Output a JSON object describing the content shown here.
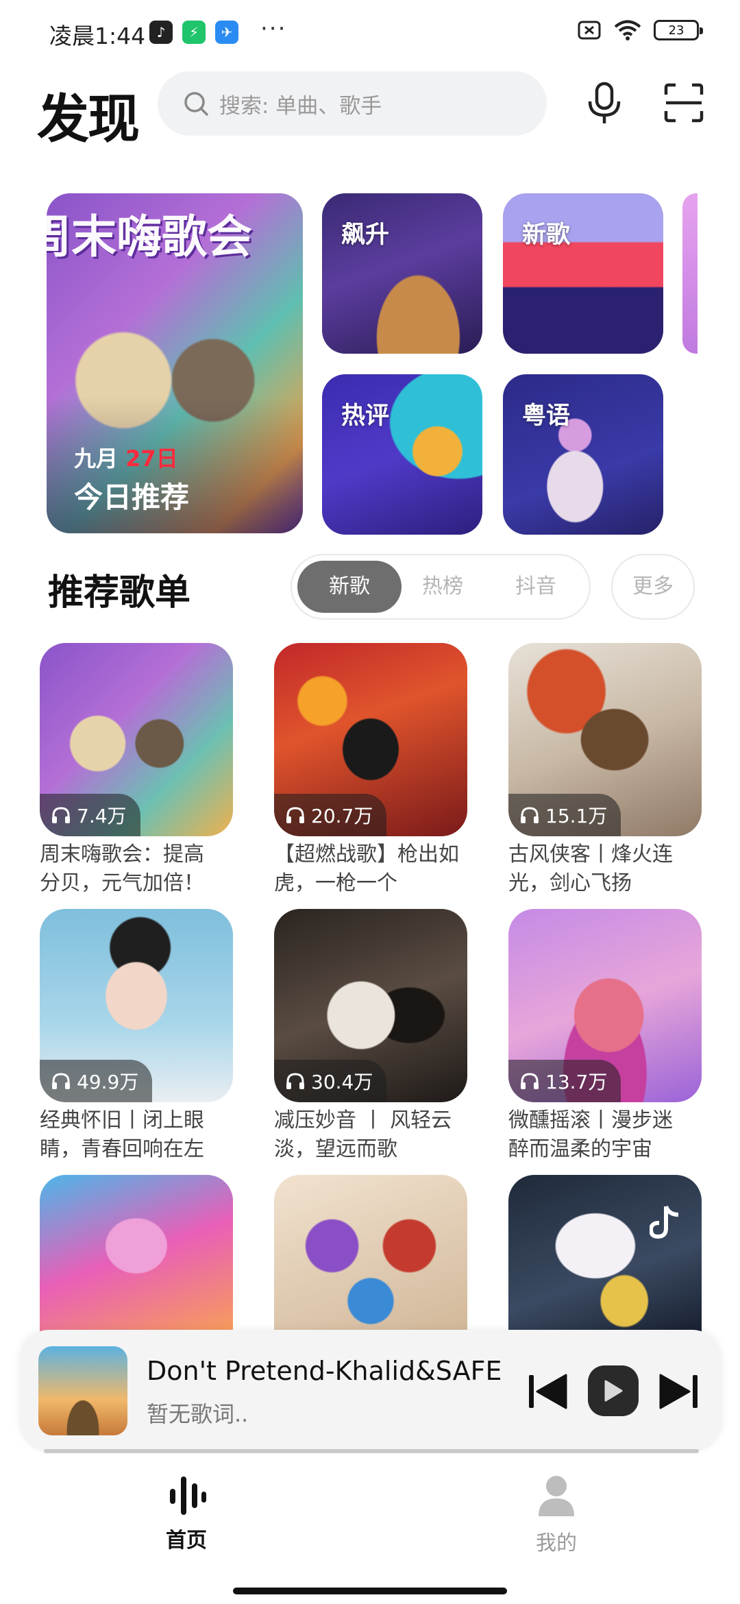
{
  "status": {
    "time": "凌晨1:44",
    "more": "···",
    "battery": "23"
  },
  "header": {
    "title": "发现",
    "search_placeholder": "搜索: 单曲、歌手"
  },
  "banners": {
    "big": {
      "art_title": "周末嗨歌会",
      "month": "九月",
      "day": "27日",
      "label": "今日推荐"
    },
    "small": [
      {
        "label": "飙升"
      },
      {
        "label": "新歌"
      },
      {
        "label": "热评"
      },
      {
        "label": "粤语"
      }
    ]
  },
  "section": {
    "title": "推荐歌单",
    "tabs": [
      "新歌",
      "热榜",
      "抖音"
    ],
    "more": "更多"
  },
  "playlists": [
    {
      "count": "7.4万",
      "title_line1": "周末嗨歌会：提高",
      "title_line2": "分贝，元气加倍！"
    },
    {
      "count": "20.7万",
      "title_line1": "【超燃战歌】枪出如",
      "title_line2": "虎，一枪一个"
    },
    {
      "count": "15.1万",
      "title_line1": "古风侠客丨烽火连",
      "title_line2": "光，剑心飞扬"
    },
    {
      "count": "49.9万",
      "title_line1": "经典怀旧丨闭上眼",
      "title_line2": "睛，青春回响在左"
    },
    {
      "count": "30.4万",
      "title_line1": "减压妙音 丨 风轻云",
      "title_line2": "淡，望远而歌"
    },
    {
      "count": "13.7万",
      "title_line1": "微醺摇滚丨漫步迷",
      "title_line2": "醉而温柔的宇宙"
    }
  ],
  "player": {
    "song": "Don't Pretend-Khalid&SAFE",
    "lyric": "暂无歌词..",
    "progress": 0.0
  },
  "nav": {
    "home": "首页",
    "mine": "我的"
  }
}
